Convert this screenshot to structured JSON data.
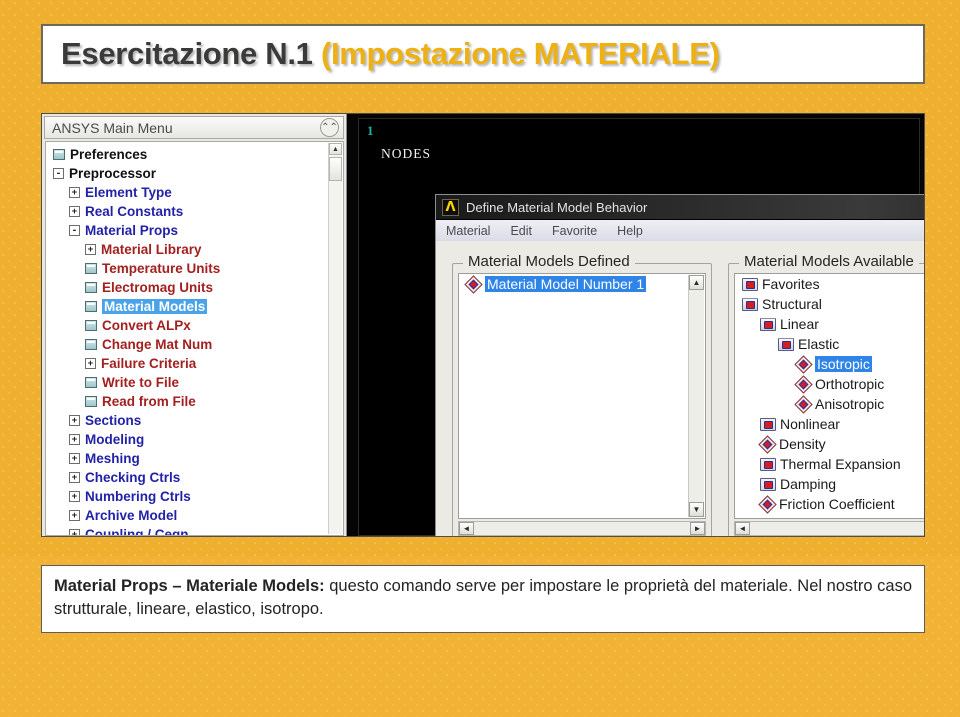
{
  "slide": {
    "title_dark": "Esercitazione N.1 ",
    "title_gold": "(Impostazione MATERIALE)",
    "background_color": "#f0b02f"
  },
  "main_menu": {
    "header_title": "ANSYS Main Menu",
    "collapse_icon": "double-chevron-up-icon",
    "items": [
      {
        "label": "Preferences",
        "indent": 0,
        "toggle": "",
        "icon": "sheet-icon",
        "color": "black",
        "selected": false
      },
      {
        "label": "Preprocessor",
        "indent": 0,
        "toggle": "-",
        "icon": "",
        "color": "black",
        "selected": false
      },
      {
        "label": "Element Type",
        "indent": 1,
        "toggle": "+",
        "icon": "",
        "color": "blue",
        "selected": false
      },
      {
        "label": "Real Constants",
        "indent": 1,
        "toggle": "+",
        "icon": "",
        "color": "blue",
        "selected": false
      },
      {
        "label": "Material Props",
        "indent": 1,
        "toggle": "-",
        "icon": "",
        "color": "blue",
        "selected": false
      },
      {
        "label": "Material Library",
        "indent": 2,
        "toggle": "+",
        "icon": "",
        "color": "red",
        "selected": false
      },
      {
        "label": "Temperature Units",
        "indent": 2,
        "toggle": "",
        "icon": "sheet-icon",
        "color": "red",
        "selected": false
      },
      {
        "label": "Electromag Units",
        "indent": 2,
        "toggle": "",
        "icon": "sheet-icon",
        "color": "red",
        "selected": false
      },
      {
        "label": "Material Models",
        "indent": 2,
        "toggle": "",
        "icon": "sheet-icon",
        "color": "red",
        "selected": true
      },
      {
        "label": "Convert ALPx",
        "indent": 2,
        "toggle": "",
        "icon": "sheet-icon",
        "color": "red",
        "selected": false
      },
      {
        "label": "Change Mat Num",
        "indent": 2,
        "toggle": "",
        "icon": "sheet-icon",
        "color": "red",
        "selected": false
      },
      {
        "label": "Failure Criteria",
        "indent": 2,
        "toggle": "+",
        "icon": "",
        "color": "red",
        "selected": false
      },
      {
        "label": "Write to File",
        "indent": 2,
        "toggle": "",
        "icon": "sheet-icon",
        "color": "red",
        "selected": false
      },
      {
        "label": "Read from File",
        "indent": 2,
        "toggle": "",
        "icon": "sheet-icon",
        "color": "red",
        "selected": false
      },
      {
        "label": "Sections",
        "indent": 1,
        "toggle": "+",
        "icon": "",
        "color": "blue",
        "selected": false
      },
      {
        "label": "Modeling",
        "indent": 1,
        "toggle": "+",
        "icon": "",
        "color": "blue",
        "selected": false
      },
      {
        "label": "Meshing",
        "indent": 1,
        "toggle": "+",
        "icon": "",
        "color": "blue",
        "selected": false
      },
      {
        "label": "Checking Ctrls",
        "indent": 1,
        "toggle": "+",
        "icon": "",
        "color": "blue",
        "selected": false
      },
      {
        "label": "Numbering Ctrls",
        "indent": 1,
        "toggle": "+",
        "icon": "",
        "color": "blue",
        "selected": false
      },
      {
        "label": "Archive Model",
        "indent": 1,
        "toggle": "+",
        "icon": "",
        "color": "blue",
        "selected": false
      },
      {
        "label": "Coupling / Ceqn",
        "indent": 1,
        "toggle": "+",
        "icon": "",
        "color": "blue",
        "selected": false
      }
    ]
  },
  "graphics": {
    "window_number": "1",
    "plot_label": "NODES"
  },
  "dialog": {
    "logo_icon": "ansys-lambda-icon",
    "title": "Define Material Model Behavior",
    "menus": [
      "Material",
      "Edit",
      "Favorite",
      "Help"
    ],
    "left_group_label": "Material Models Defined",
    "right_group_label": "Material Models Available",
    "defined_items": [
      {
        "label": "Material Model Number 1",
        "indent": 0,
        "icon": "diamond-icon",
        "selected": true
      }
    ],
    "available_items": [
      {
        "label": "Favorites",
        "indent": 0,
        "icon": "folder-icon",
        "selected": false
      },
      {
        "label": "Structural",
        "indent": 0,
        "icon": "folder-open-icon",
        "selected": false
      },
      {
        "label": "Linear",
        "indent": 1,
        "icon": "folder-open-icon",
        "selected": false
      },
      {
        "label": "Elastic",
        "indent": 2,
        "icon": "folder-open-icon",
        "selected": false
      },
      {
        "label": "Isotropic",
        "indent": 3,
        "icon": "diamond-icon",
        "selected": true
      },
      {
        "label": "Orthotropic",
        "indent": 3,
        "icon": "diamond-icon",
        "selected": false
      },
      {
        "label": "Anisotropic",
        "indent": 3,
        "icon": "diamond-icon",
        "selected": false
      },
      {
        "label": "Nonlinear",
        "indent": 1,
        "icon": "folder-icon",
        "selected": false
      },
      {
        "label": "Density",
        "indent": 1,
        "icon": "diamond-icon",
        "selected": false
      },
      {
        "label": "Thermal Expansion",
        "indent": 1,
        "icon": "folder-icon",
        "selected": false
      },
      {
        "label": "Damping",
        "indent": 1,
        "icon": "folder-icon",
        "selected": false
      },
      {
        "label": "Friction Coefficient",
        "indent": 1,
        "icon": "diamond-icon",
        "selected": false
      }
    ],
    "scroll_up_glyph": "▲",
    "scroll_down_glyph": "▼",
    "scroll_left_glyph": "◄",
    "scroll_right_glyph": "►"
  },
  "caption": {
    "bold_lead": "Material Props – Materiale Models:",
    "body": " questo comando serve per impostare le proprietà del materiale. Nel nostro caso strutturale, lineare, elastico, isotropo."
  }
}
